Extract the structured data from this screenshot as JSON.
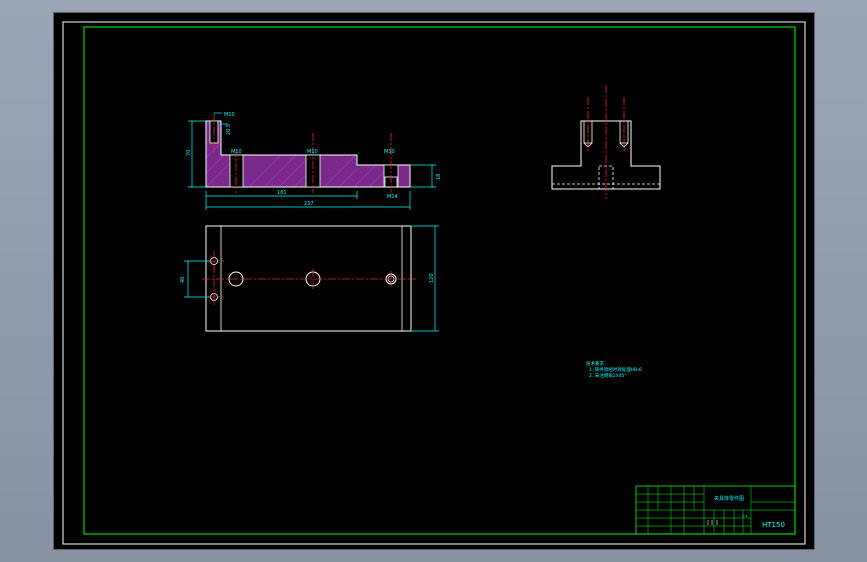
{
  "colors": {
    "frame": "#00ff00",
    "part": "#ffffff",
    "center": "#ff2020",
    "dim": "#00ffff",
    "hatch": "#c040ff",
    "background": "#000000",
    "window": "#8f9bab"
  },
  "front_view": {
    "dims": {
      "overall_length": "237",
      "inner_length": "181",
      "height": "70",
      "step_height": "18",
      "hole_a": "M10",
      "hole_b": "M10",
      "hole_c": "M10",
      "hole_d": "M14",
      "top_bore": "M10",
      "top_bore_depth": "20.5"
    }
  },
  "plan_view": {
    "dims": {
      "hole_spacing": "40",
      "width": "120"
    }
  },
  "notes": {
    "heading": "技术要求",
    "item1": "1. 铸件须经时效处理HB-6",
    "item2": "2. 未注倒角2X45°"
  },
  "title_block": {
    "part_name": "夹具体零件图",
    "drawing_code": "HT150",
    "scale": "1:1"
  }
}
